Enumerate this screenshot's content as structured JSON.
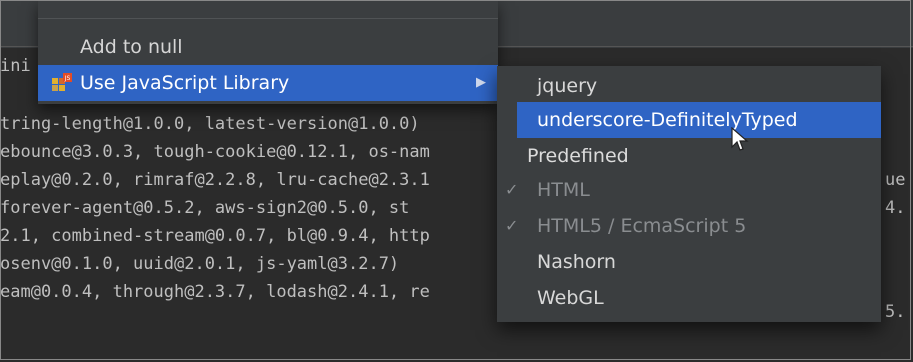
{
  "console": {
    "lines": [
      "ini",
      "tring-length@1.0.0, latest-version@1.0.0)",
      "ebounce@3.0.3, tough-cookie@0.12.1, os-nam",
      "eplay@0.2.0, rimraf@2.2.8, lru-cache@2.3.1",
      " forever-agent@0.5.2, aws-sign2@0.5.0, st",
      "2.1, combined-stream@0.0.7, bl@0.9.4, http",
      " osenv@0.1.0, uuid@2.0.1, js-yaml@3.2.7)",
      "eam@0.0.4, through@2.3.7, lodash@2.4.1, re"
    ],
    "right_fragments": [
      "ue",
      "4.",
      "5."
    ]
  },
  "context_menu": {
    "items": [
      {
        "label": "Add to null"
      },
      {
        "label": "Use JavaScript Library",
        "has_submenu": true
      }
    ]
  },
  "library_submenu": {
    "items": [
      {
        "label": "jquery",
        "selected": false
      },
      {
        "label": "underscore-DefinitelyTyped",
        "selected": true
      }
    ],
    "predefined_header": "Predefined",
    "predefined": [
      {
        "label": "HTML",
        "checked": true,
        "disabled": true
      },
      {
        "label": "HTML5 / EcmaScript 5",
        "checked": true,
        "disabled": true
      },
      {
        "label": "Nashorn",
        "checked": false,
        "disabled": false
      },
      {
        "label": "WebGL",
        "checked": false,
        "disabled": false
      }
    ]
  },
  "colors": {
    "selection": "#2f64c4",
    "menu_bg": "#3b3e40",
    "console_bg": "#2b2b2b",
    "console_text": "#bfbfbf"
  }
}
